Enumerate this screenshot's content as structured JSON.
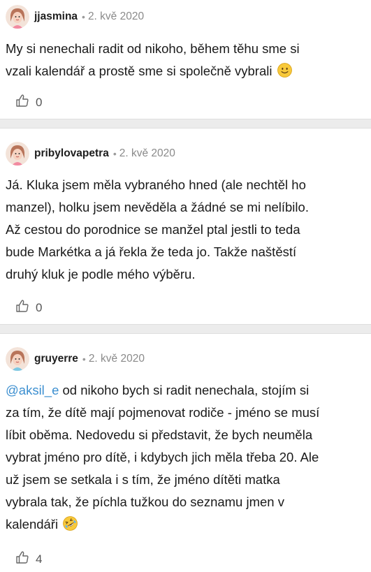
{
  "comments": [
    {
      "username": "jjasmina",
      "separator": "•",
      "date": "2. kvě 2020",
      "lines": [
        "My si nenechali radit od nikoho, během těhu sme si",
        "vzali kalendář a prostě sme si společně vybrali"
      ],
      "emoji": "slightly-smiling-face",
      "likes": "0"
    },
    {
      "username": "pribylovapetra",
      "separator": "•",
      "date": "2. kvě 2020",
      "lines": [
        "Já. Kluka jsem měla vybraného hned (ale nechtěl ho",
        "manzel), holku jsem nevěděla a žádné se mi nelíbilo.",
        "Až cestou do porodnice se manžel ptal jestli to teda",
        "bude Markétka a já řekla že teda jo. Takže naštěstí",
        "druhý kluk je podle mého výběru."
      ],
      "likes": "0"
    },
    {
      "username": "gruyerre",
      "separator": "•",
      "date": "2. kvě 2020",
      "mention": "@aksil_e",
      "lines": [
        " od nikoho bych si radit nenechala, stojím si",
        "za tím, že dítě mají pojmenovat rodiče - jméno se musí",
        "líbit oběma. Nedovedu si představit, že bych neuměla",
        "vybrat jméno pro dítě, i kdybych jich měla třeba 20. Ale",
        "už jsem se setkala i s tím, že jméno dítěti matka",
        "vybrala tak, že píchla tužkou do seznamu jmen v",
        "kalendáři"
      ],
      "emoji": "rolling-on-the-floor-laughing",
      "likes": "4"
    }
  ],
  "icons": {
    "like": "thumbs-up-outline-icon",
    "avatar": "cartoon-avatar"
  },
  "colors": {
    "mention": "#3c8fd0",
    "separator_bg": "#ececec",
    "meta_text": "#8a8a8a"
  }
}
